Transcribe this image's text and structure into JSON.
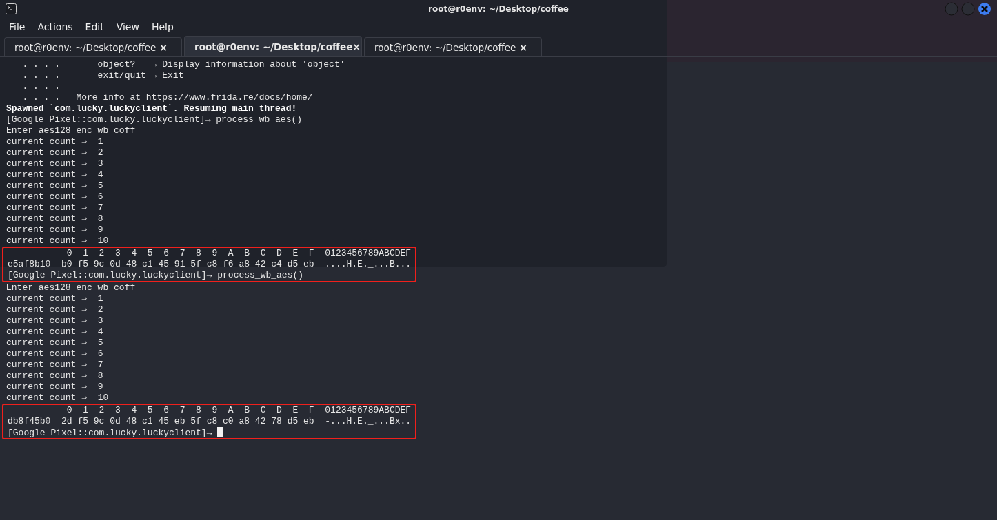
{
  "window": {
    "title": "root@r0env: ~/Desktop/coffee"
  },
  "menu": [
    "File",
    "Actions",
    "Edit",
    "View",
    "Help"
  ],
  "tabs": [
    {
      "label": "root@r0env: ~/Desktop/coffee",
      "close": "×",
      "selected": false
    },
    {
      "label": "root@r0env: ~/Desktop/coffee",
      "close": "×",
      "selected": true
    },
    {
      "label": "root@r0env: ~/Desktop/coffee",
      "close": "×",
      "selected": false
    }
  ],
  "terminal": {
    "blocks": [
      {
        "kind": "plain",
        "lines": [
          "   . . . .       object?   → Display information about 'object'",
          "   . . . .       exit/quit → Exit",
          "   . . . .",
          "   . . . .   More info at https://www.frida.re/docs/home/"
        ]
      },
      {
        "kind": "bold",
        "lines": [
          "Spawned `com.lucky.luckyclient`. Resuming main thread!"
        ]
      },
      {
        "kind": "plain",
        "lines": [
          "[Google Pixel::com.lucky.luckyclient]→ process_wb_aes()",
          "Enter aes128_enc_wb_coff",
          "current count ⇒  1",
          "current count ⇒  2",
          "current count ⇒  3",
          "current count ⇒  4",
          "current count ⇒  5",
          "current count ⇒  6",
          "current count ⇒  7",
          "current count ⇒  8",
          "current count ⇒  9",
          "current count ⇒  10"
        ]
      },
      {
        "kind": "highlight",
        "cursor": false,
        "lines": [
          "           0  1  2  3  4  5  6  7  8  9  A  B  C  D  E  F  0123456789ABCDEF",
          "e5af8b10  b0 f5 9c 0d 48 c1 45 91 5f c8 f6 a8 42 c4 d5 eb  ....H.E._...B...",
          "[Google Pixel::com.lucky.luckyclient]→ process_wb_aes()"
        ]
      },
      {
        "kind": "plain",
        "lines": [
          "Enter aes128_enc_wb_coff",
          "current count ⇒  1",
          "current count ⇒  2",
          "current count ⇒  3",
          "current count ⇒  4",
          "current count ⇒  5",
          "current count ⇒  6",
          "current count ⇒  7",
          "current count ⇒  8",
          "current count ⇒  9",
          "current count ⇒  10"
        ]
      },
      {
        "kind": "highlight",
        "cursor": true,
        "lines": [
          "           0  1  2  3  4  5  6  7  8  9  A  B  C  D  E  F  0123456789ABCDEF",
          "db8f45b0  2d f5 9c 0d 48 c1 45 eb 5f c8 c0 a8 42 78 d5 eb  -...H.E._...Bx..",
          "[Google Pixel::com.lucky.luckyclient]→"
        ]
      }
    ]
  }
}
